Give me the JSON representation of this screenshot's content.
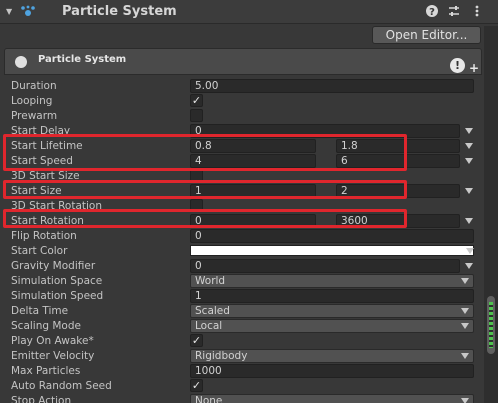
{
  "header": {
    "title": "Particle System",
    "icons": [
      "help-icon",
      "settings-sliders-icon",
      "kebab-menu-icon"
    ]
  },
  "open_editor_label": "Open Editor...",
  "module": {
    "title": "Particle System"
  },
  "fields": {
    "duration": {
      "label": "Duration",
      "value": "5.00"
    },
    "looping": {
      "label": "Looping",
      "checked": true
    },
    "prewarm": {
      "label": "Prewarm",
      "checked": false
    },
    "start_delay": {
      "label": "Start Delay",
      "value": "0"
    },
    "start_lifetime": {
      "label": "Start Lifetime",
      "min": "0.8",
      "max": "1.8"
    },
    "start_speed": {
      "label": "Start Speed",
      "min": "4",
      "max": "6"
    },
    "start_size_3d": {
      "label": "3D Start Size",
      "checked": false
    },
    "start_size": {
      "label": "Start Size",
      "min": "1",
      "max": "2"
    },
    "start_rotation_3d": {
      "label": "3D Start Rotation",
      "checked": false
    },
    "start_rotation": {
      "label": "Start Rotation",
      "min": "0",
      "max": "3600"
    },
    "flip_rotation": {
      "label": "Flip Rotation",
      "value": "0"
    },
    "start_color": {
      "label": "Start Color",
      "color": "#ffffff"
    },
    "gravity_modifier": {
      "label": "Gravity Modifier",
      "value": "0"
    },
    "simulation_space": {
      "label": "Simulation Space",
      "value": "World"
    },
    "simulation_speed": {
      "label": "Simulation Speed",
      "value": "1"
    },
    "delta_time": {
      "label": "Delta Time",
      "value": "Scaled"
    },
    "scaling_mode": {
      "label": "Scaling Mode",
      "value": "Local"
    },
    "play_on_awake": {
      "label": "Play On Awake*",
      "checked": true
    },
    "emitter_velocity": {
      "label": "Emitter Velocity",
      "value": "Rigidbody"
    },
    "max_particles": {
      "label": "Max Particles",
      "value": "1000"
    },
    "auto_random_seed": {
      "label": "Auto Random Seed",
      "checked": true
    },
    "stop_action": {
      "label": "Stop Action",
      "value": "None"
    }
  },
  "colors": {
    "highlight": "#e0262d",
    "background": "#383838",
    "field": "#2a2a2a"
  }
}
